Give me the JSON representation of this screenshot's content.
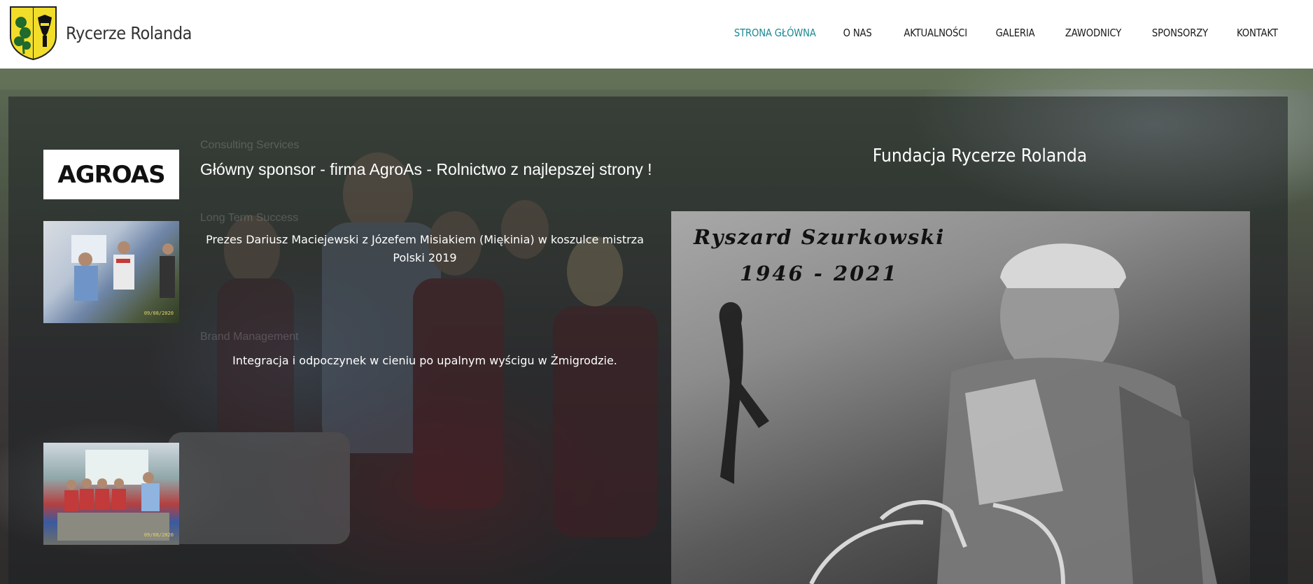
{
  "header": {
    "brand": "Rycerze Rolanda",
    "nav": [
      {
        "label": "STRONA GŁÓWNA",
        "active": true
      },
      {
        "label": "O NAS",
        "active": false
      },
      {
        "label": "AKTUALNOŚCI",
        "active": false
      },
      {
        "label": "GALERIA",
        "active": false
      },
      {
        "label": "ZAWODNICY",
        "active": false
      },
      {
        "label": "SPONSORZY",
        "active": false
      },
      {
        "label": "KONTAKT",
        "active": false
      }
    ],
    "active_color": "#1b8a94"
  },
  "slider": {
    "sponsor_logo": "AGROAS",
    "headline": "Główny sponsor - firma AgroAs - Rolnictwo z najlepszej strony !",
    "items": [
      {
        "caption": "Prezes Dariusz Maciejewski z Józefem Misiakiem (Miękinia) w koszulce mistrza Polski 2019",
        "stamp": "09/08/2020"
      },
      {
        "caption": "Integracja i odpoczynek w cieniu po upalnym wyścigu w Żmigrodzie.",
        "stamp": "09/08/2020"
      }
    ],
    "ghost_labels": [
      "Consulting Services",
      "Long Term Success",
      "Brand Management"
    ]
  },
  "sidebar": {
    "title": "Fundacja Rycerze Rolanda",
    "memorial_name": "Ryszard Szurkowski",
    "memorial_years": "1946 - 2021"
  }
}
